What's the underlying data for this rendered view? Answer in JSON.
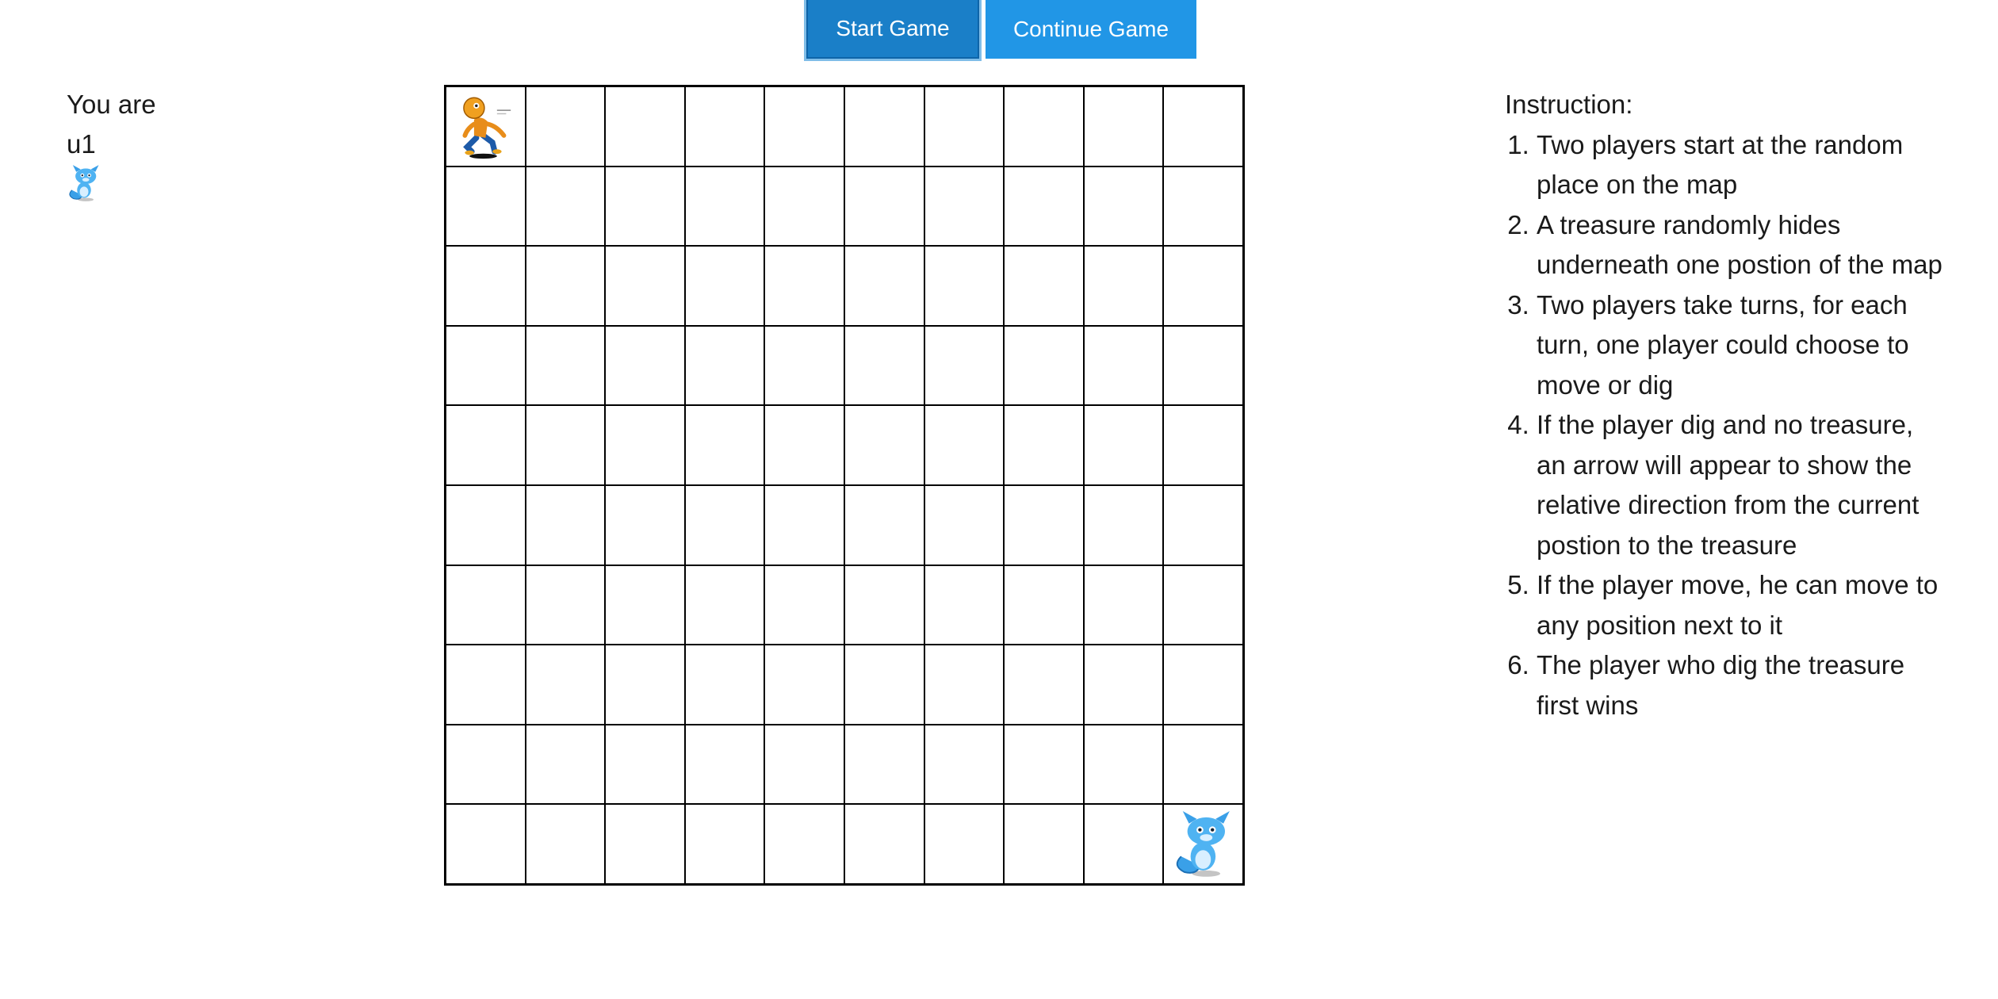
{
  "buttons": {
    "start_label": "Start Game",
    "continue_label": "Continue Game"
  },
  "player": {
    "prefix": "You are",
    "name": "u1",
    "avatar_icon": "blue-fox-icon"
  },
  "board": {
    "rows": 10,
    "cols": 10,
    "pieces": [
      {
        "row": 0,
        "col": 0,
        "icon": "runner-icon"
      },
      {
        "row": 9,
        "col": 9,
        "icon": "blue-fox-icon"
      }
    ]
  },
  "instructions": {
    "title": "Instruction:",
    "items": [
      "Two players start at the random place on the map",
      "A treasure randomly hides underneath one postion of the map",
      "Two players take turns, for each turn, one player could choose to move or dig",
      "If the player dig and no treasure, an arrow will appear to show the relative direction from the current postion to the treasure",
      "If the player move, he can move to any position next to it",
      "The player who dig the treasure first wins"
    ]
  },
  "colors": {
    "start_button": "#1a7fc8",
    "continue_button": "#2196e6",
    "grid_line": "#000000"
  }
}
